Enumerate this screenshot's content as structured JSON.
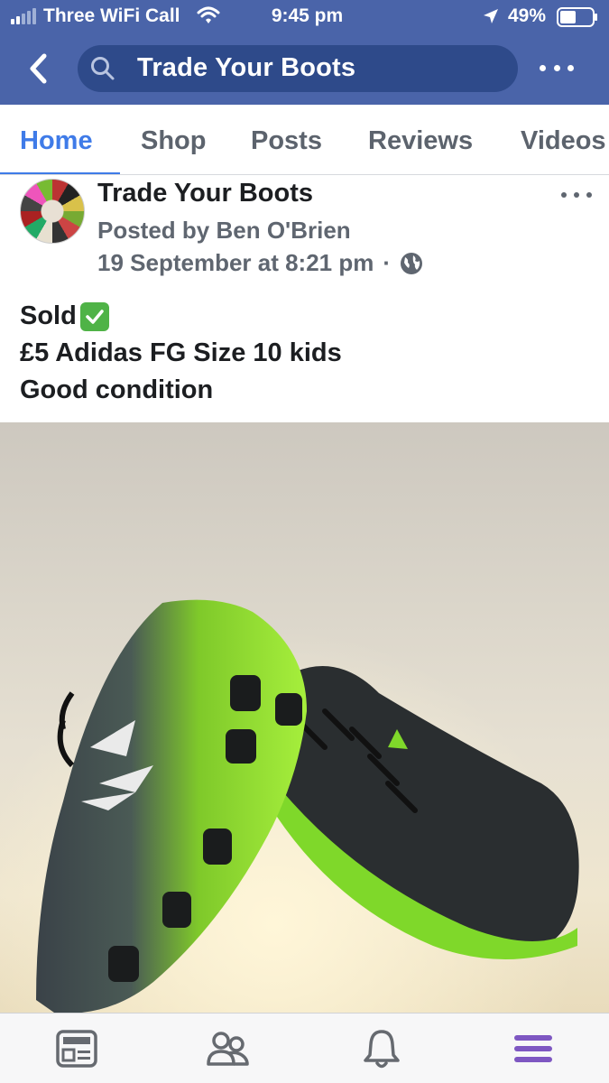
{
  "status_bar": {
    "carrier": "Three WiFi Call",
    "time": "9:45 pm",
    "battery": "49%",
    "icons": [
      "signal-icon",
      "wifi-icon",
      "location-arrow-icon",
      "battery-icon"
    ]
  },
  "header": {
    "search_text": "Trade Your Boots",
    "icons": [
      "back-icon",
      "search-icon",
      "more-icon"
    ],
    "color": "#4a64a9"
  },
  "tabs": [
    {
      "label": "Home",
      "active": true
    },
    {
      "label": "Shop",
      "active": false
    },
    {
      "label": "Posts",
      "active": false
    },
    {
      "label": "Reviews",
      "active": false
    },
    {
      "label": "Videos",
      "active": false
    }
  ],
  "post": {
    "page_name": "Trade Your Boots",
    "posted_by": "Posted by Ben O'Brien",
    "date": "19 September at 8:21 pm",
    "separator": "·",
    "privacy_icon": "globe-icon",
    "body": {
      "line1": "Sold",
      "line1_emoji": "check-mark-button-emoji",
      "line2": "£5 Adidas FG Size 10 kids",
      "line3": "Good condition"
    },
    "photo_alt": "adidas football boots"
  },
  "bottom_nav": [
    "news-feed-icon",
    "groups-icon",
    "notifications-bell-icon",
    "menu-icon"
  ],
  "colors": {
    "accent": "#3f7be8",
    "menu_active": "#7e57c2"
  }
}
